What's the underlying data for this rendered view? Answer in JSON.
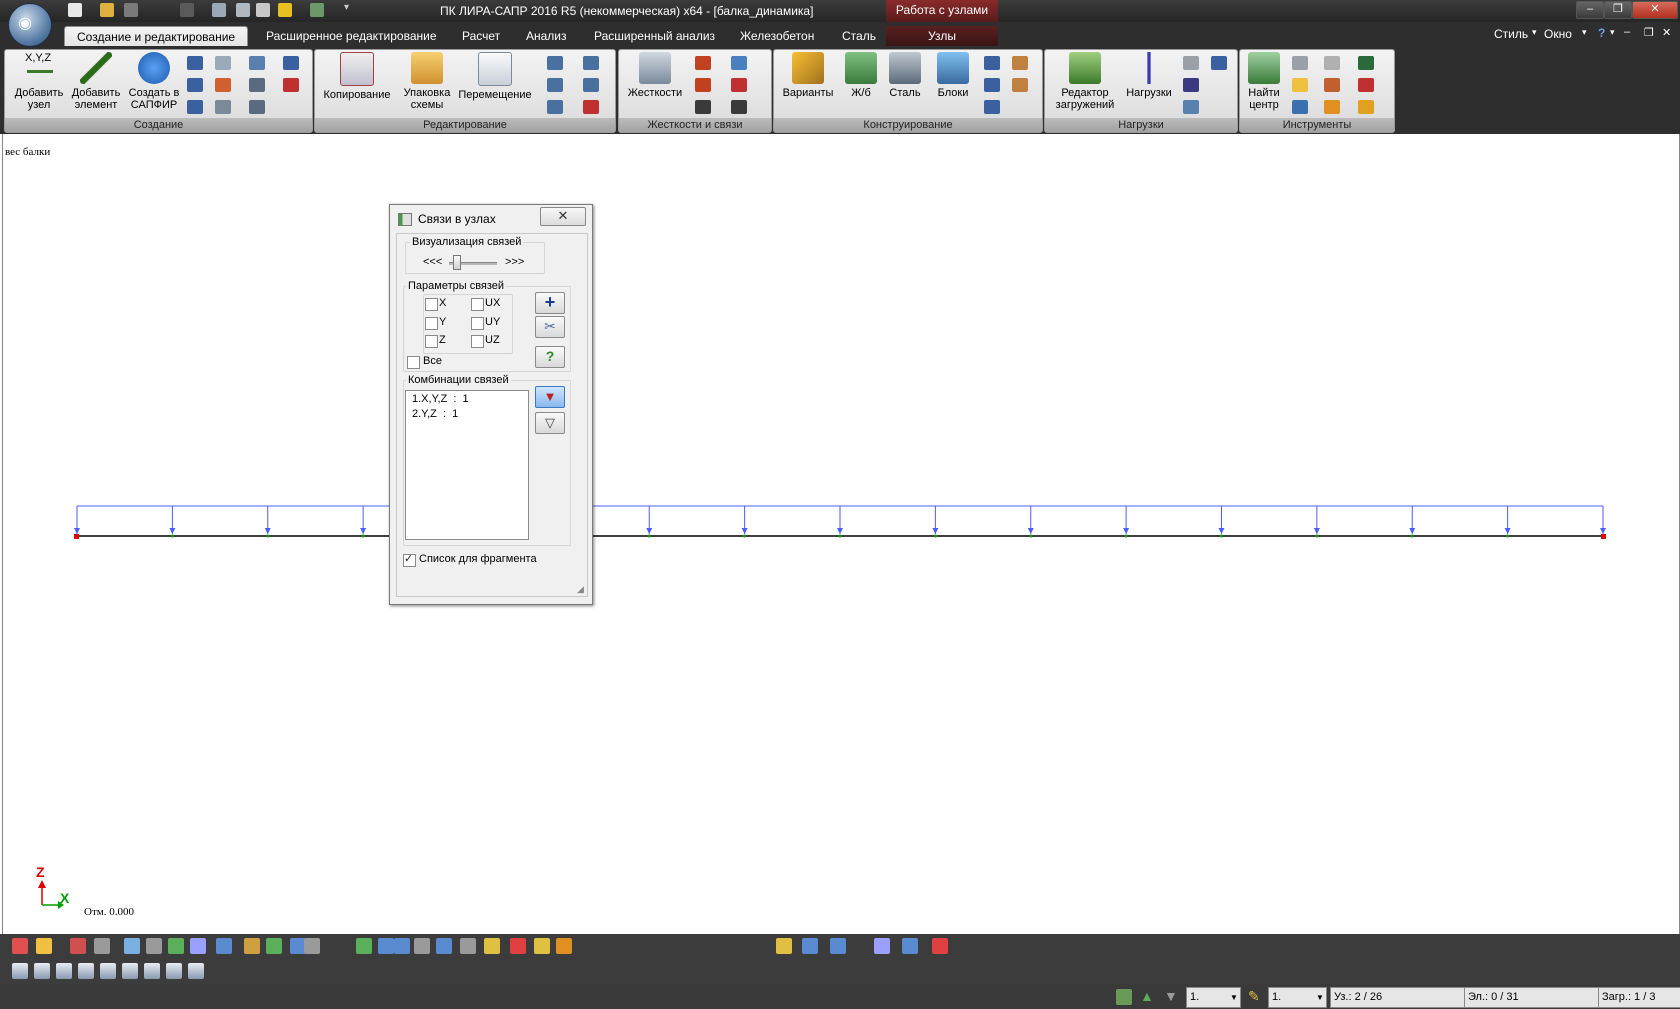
{
  "window": {
    "title": "ПК ЛИРА-САПР  2016 R5 (некоммерческая) x64 - [балка_динамика]",
    "context_tab_title": "Работа с узлами",
    "orb_label": "ЛИРА"
  },
  "tabs": [
    {
      "label": "Создание и редактирование",
      "active": true
    },
    {
      "label": "Расширенное редактирование"
    },
    {
      "label": "Расчет"
    },
    {
      "label": "Анализ"
    },
    {
      "label": "Расширенный анализ"
    },
    {
      "label": "Железобетон"
    },
    {
      "label": "Сталь"
    },
    {
      "label": "Узлы"
    }
  ],
  "right_menu": {
    "style": "Стиль",
    "window": "Окно",
    "help": "?"
  },
  "ribbon": {
    "groups": [
      {
        "label": "Создание",
        "buttons": [
          "Добавить\nузел",
          "Добавить\nэлемент",
          "Создать в\nСАПФИР"
        ]
      },
      {
        "label": "Редактирование",
        "buttons": [
          "Копирование",
          "Упаковка\nсхемы",
          "Перемещение"
        ]
      },
      {
        "label": "Жесткости и связи",
        "buttons": [
          "Жесткости"
        ]
      },
      {
        "label": "Конструирование",
        "buttons": [
          "Варианты",
          "Ж/б",
          "Сталь",
          "Блоки"
        ]
      },
      {
        "label": "Нагрузки",
        "buttons": [
          "Редактор\nзагружений",
          "Нагрузки"
        ]
      },
      {
        "label": "Инструменты",
        "buttons": [
          "Найти\nцентр"
        ]
      }
    ],
    "xyz_label": "X,Y,Z"
  },
  "canvas": {
    "case_label": "вес балки",
    "elevation": "Отм. 0.000",
    "axis_z": "Z",
    "axis_x": "X"
  },
  "dialog": {
    "title": "Связи в узлах",
    "close_glyph": "✕",
    "visual_group": "Визуализация связей",
    "visual_left": "<<<",
    "visual_right": ">>>",
    "params_group": "Параметры связей",
    "checks": {
      "x": "X",
      "y": "Y",
      "z": "Z",
      "ux": "UX",
      "uy": "UY",
      "uz": "UZ",
      "all": "Все"
    },
    "combos_group": "Комбинации связей",
    "combos": [
      "1.X,Y,Z  :  1",
      "2.Y,Z  :  1"
    ],
    "fragment_list": "Список для фрагмента",
    "help_glyph": "?"
  },
  "statusbar": {
    "combo1": "1.",
    "combo2": "1.",
    "nodes": "Уз.: 2 / 26",
    "elements": "Эл.: 0 / 31",
    "loads": "Загр.: 1 / 3"
  },
  "colors": {
    "dark_chrome": "#2e2e2e",
    "load_blue": "#4d5cff",
    "beam": "#000000",
    "support_red": "#e00000",
    "axis_z": "#e00000",
    "axis_x": "#00a000"
  }
}
